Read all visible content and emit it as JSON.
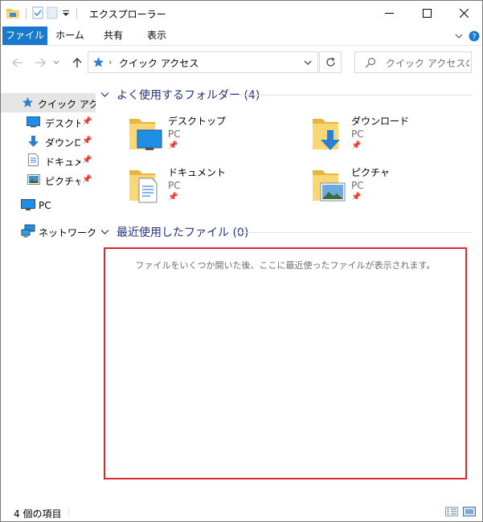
{
  "window": {
    "title": "エクスプローラー"
  },
  "ribbon": {
    "tabs": [
      {
        "label": "ファイル"
      },
      {
        "label": "ホーム"
      },
      {
        "label": "共有"
      },
      {
        "label": "表示"
      }
    ],
    "accent": "#1979ca"
  },
  "address": {
    "path": "クイック アクセス",
    "search_placeholder": "クイック アクセスの検..."
  },
  "nav": {
    "items": [
      {
        "label": "クイック アクセス",
        "icon": "star-icon",
        "pinned": false,
        "selected": true
      },
      {
        "label": "デスクトップ",
        "icon": "desktop-icon",
        "pinned": true
      },
      {
        "label": "ダウンロード",
        "icon": "download-icon",
        "pinned": true
      },
      {
        "label": "ドキュメント",
        "icon": "document-icon",
        "pinned": true
      },
      {
        "label": "ピクチャ",
        "icon": "picture-icon",
        "pinned": true
      },
      {
        "label": "PC",
        "icon": "pc-icon",
        "pinned": false
      },
      {
        "label": "ネットワーク",
        "icon": "network-icon",
        "pinned": false
      }
    ]
  },
  "content": {
    "frequent_header": "よく使用するフォルダー (4)",
    "folders": [
      {
        "name": "デスクトップ",
        "location": "PC",
        "icon": "desktop-folder-icon"
      },
      {
        "name": "ダウンロード",
        "location": "PC",
        "icon": "download-folder-icon"
      },
      {
        "name": "ドキュメント",
        "location": "PC",
        "icon": "document-folder-icon"
      },
      {
        "name": "ピクチャ",
        "location": "PC",
        "icon": "picture-folder-icon"
      }
    ],
    "recent_header": "最近使用したファイル (0)",
    "recent_empty_message": "ファイルをいくつか開いた後、ここに最近使ったファイルが表示されます。",
    "highlight_color": "#e0262d"
  },
  "status": {
    "item_count": "4 個の項目"
  }
}
